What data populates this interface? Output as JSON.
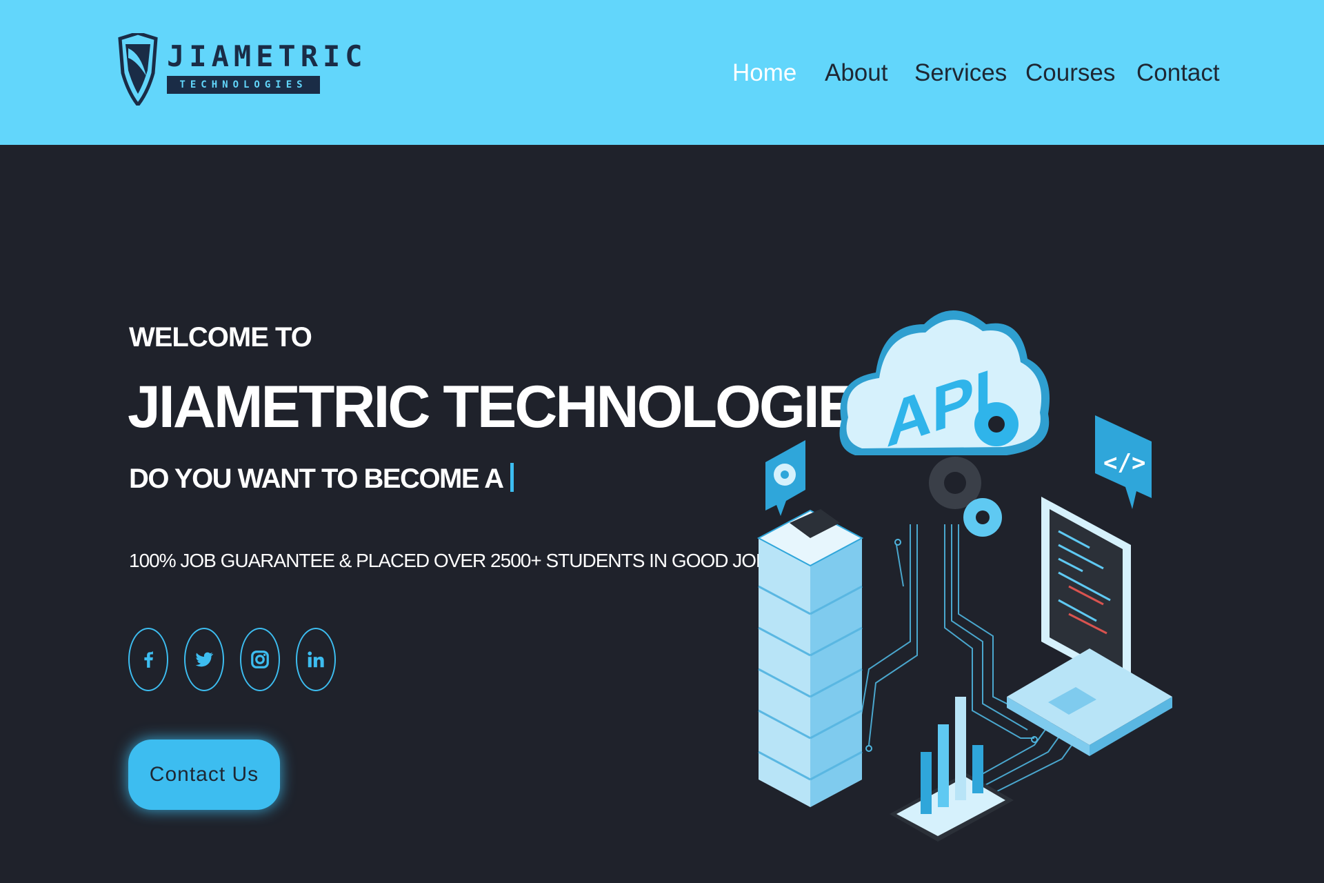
{
  "brand": {
    "name": "JIAMETRIC",
    "tagline": "TECHNOLOGIES"
  },
  "nav": {
    "items": [
      {
        "label": "Home",
        "active": true
      },
      {
        "label": "About",
        "active": false
      },
      {
        "label": "Services",
        "active": false
      },
      {
        "label": "Courses",
        "active": false
      },
      {
        "label": "Contact",
        "active": false
      }
    ]
  },
  "hero": {
    "welcome": "WELCOME TO",
    "headline": "JIAMETRIC TECHNOLOGIES",
    "question": "DO YOU WANT TO BECOME A",
    "tagline": "100% JOB GUARANTEE & PLACED OVER 2500+ STUDENTS IN GOOD JOB",
    "socials": [
      "facebook-icon",
      "twitter-icon",
      "instagram-icon",
      "linkedin-icon"
    ],
    "cta_label": "Contact Us",
    "illustration_text": "API"
  },
  "colors": {
    "header_bg": "#62d6fb",
    "page_bg": "#1f222b",
    "accent": "#3dbdf0",
    "nav_text": "#1e2733",
    "nav_active": "#ffffff"
  }
}
